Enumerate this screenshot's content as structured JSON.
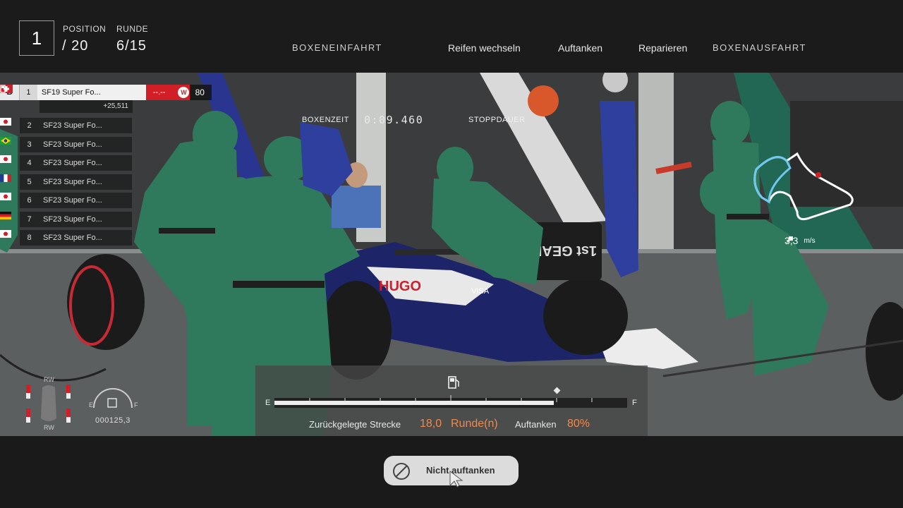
{
  "race": {
    "position_label": "POSITION",
    "position_value": "/ 20",
    "position_current": "1",
    "lap_label": "RUNDE",
    "lap_value": "6/15"
  },
  "pit_steps": [
    {
      "label": "BOXENEINFAHRT"
    },
    {
      "label": "Reifen wechseln"
    },
    {
      "label": "Auftanken"
    },
    {
      "label": "Reparieren"
    },
    {
      "label": "BOXENAUSFAHRT"
    }
  ],
  "leaderboard": {
    "leader": {
      "badge": "B",
      "pos": "1",
      "name": "SF19 Super Fo...",
      "flag": "switzerland",
      "time": "--.--",
      "weather": "W",
      "fuel": "80",
      "gap": "+25,511"
    },
    "rows": [
      {
        "pos": "2",
        "name": "SF23 Super Fo...",
        "flag": "japan"
      },
      {
        "pos": "3",
        "name": "SF23 Super Fo...",
        "flag": "brazil"
      },
      {
        "pos": "4",
        "name": "SF23 Super Fo...",
        "flag": "japan"
      },
      {
        "pos": "5",
        "name": "SF23 Super Fo...",
        "flag": "france"
      },
      {
        "pos": "6",
        "name": "SF23 Super Fo...",
        "flag": "japan"
      },
      {
        "pos": "7",
        "name": "SF23 Super Fo...",
        "flag": "germany"
      },
      {
        "pos": "8",
        "name": "SF23 Super Fo...",
        "flag": "japan"
      }
    ]
  },
  "pit": {
    "time_label": "BOXENZEIT",
    "time_value": "0:09.460",
    "stop_label": "STOPPDAUER"
  },
  "speed": {
    "value": "3,3",
    "unit": "m/s"
  },
  "fuel": {
    "empty_label": "E",
    "full_label": "F",
    "current_level": 0.8,
    "target_level": 0.8,
    "distance_label": "Zurückgelegte Strecke",
    "distance_value": "18,0",
    "distance_unit": "Runde(n)",
    "refuel_label": "Auftanken",
    "refuel_value": "80%"
  },
  "car_status": {
    "rw_top": "RW",
    "rw_bottom": "RW",
    "odometer": "000125,3",
    "gauge_e": "E",
    "gauge_f": "F"
  },
  "actions": {
    "no_refuel_label": "Nicht auftanken"
  },
  "colors": {
    "accent_orange": "#f08a4b",
    "leader_red": "#d21e26",
    "crew_green": "#2f7a5c"
  }
}
